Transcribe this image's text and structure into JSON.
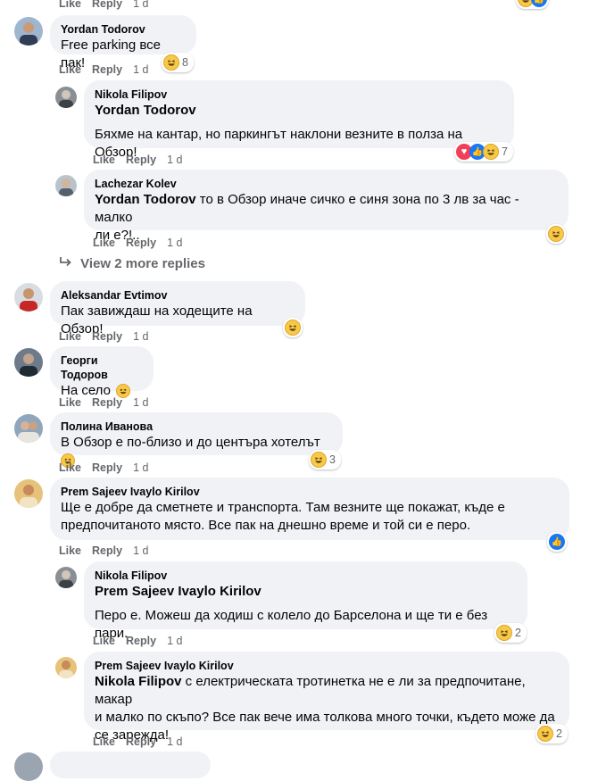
{
  "actions": {
    "like": "Like",
    "reply": "Reply"
  },
  "top_fragment": {
    "time": "1 d"
  },
  "comments": [
    {
      "author": "Yordan Todorov",
      "text": "Free parking все пак!",
      "time": "1 d",
      "reaction": {
        "types": [
          "haha"
        ],
        "count": "8"
      }
    },
    {
      "author": "Nikola Filipov",
      "tag": "Yordan Todorov",
      "text": "Бяхме на кантар, но паркингът наклони везните в полза на Обзор!",
      "time": "1 d",
      "reaction": {
        "types": [
          "love",
          "like",
          "haha"
        ],
        "count": "7"
      }
    },
    {
      "author": "Lachezar Kolev",
      "tag": "Yordan Todorov",
      "text_line1": " то в Обзор иначе сичко е синя зона по 3 лв за час - малко",
      "text_line2": "ли е?!..",
      "time": "1 d",
      "reaction": {
        "types": [
          "haha"
        ],
        "count": ""
      }
    },
    {
      "view_more": "View 2 more replies"
    },
    {
      "author": "Aleksandar Evtimov",
      "text": "Пак завиждаш на ходещите на Обзор!",
      "time": "1 d",
      "reaction": {
        "types": [
          "haha"
        ],
        "count": ""
      }
    },
    {
      "author": "Георги Тодоров",
      "text": "На село",
      "time": "1 d"
    },
    {
      "author": "Полина Иванова",
      "text": "В Обзор е по-близо и до центъра хотелът",
      "time": "1 d",
      "reaction": {
        "types": [
          "haha"
        ],
        "count": "3"
      }
    },
    {
      "author": "Prem Sajeev Ivaylo Kirilov",
      "text_line1": "Ще е добре да сметнете и транспорта. Там везните ще покажат, къде е",
      "text_line2": "предпочитаното място. Все пак на днешно време и той си е перо.",
      "time": "1 d",
      "reaction": {
        "types": [
          "like"
        ],
        "count": ""
      }
    },
    {
      "author": "Nikola Filipov",
      "tag": "Prem Sajeev Ivaylo Kirilov",
      "text": "Перо е. Можеш да ходиш с колело до Барселона и ще ти е без пари.",
      "time": "1 d",
      "reaction": {
        "types": [
          "haha"
        ],
        "count": "2"
      }
    },
    {
      "author": "Prem Sajeev Ivaylo Kirilov",
      "tag": "Nikola Filipov",
      "text_line1": " с електрическата тротинетка не е ли за предпочитане, макар",
      "text_line2": "и малко по скъпо? Все пак вече има толкова много точки, където може да",
      "text_line3": "се зарежда!",
      "time": "1 d",
      "reaction": {
        "types": [
          "haha"
        ],
        "count": "2"
      }
    }
  ],
  "colors": {
    "bubble": "#f0f2f5",
    "meta_text": "#65676b",
    "like_blue": "#1877f2",
    "love_red": "#f33e58",
    "haha_yellow": "#f7c948"
  }
}
